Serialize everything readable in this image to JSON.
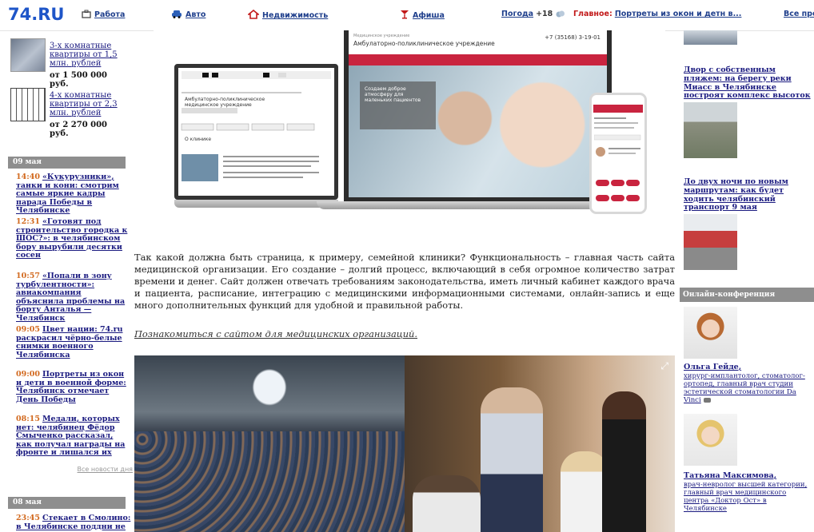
{
  "topbar": {
    "logo": "74.RU",
    "nav": [
      {
        "label": "Работа",
        "icon": "briefcase-icon"
      },
      {
        "label": "Авто",
        "icon": "car-icon"
      },
      {
        "label": "Недвижимость",
        "icon": "house-icon"
      },
      {
        "label": "Афиша",
        "icon": "cocktail-icon"
      }
    ],
    "weather": {
      "label": "Погода",
      "temp": "+18",
      "icon": "cloud-icon"
    },
    "headline_label": "Главное:",
    "headline": "Портреты из окон и детн в...",
    "all_label": "Все про"
  },
  "left": {
    "ads": [
      {
        "title": "3-х комнатные квартиры от 1,5 млн. рублей",
        "price": "от 1 500 000 руб."
      },
      {
        "title": "4-х комнатные квартиры от 2,3 млн. рублей",
        "price": "от 2 270 000 руб."
      }
    ],
    "dates": [
      "09 мая",
      "08 мая"
    ],
    "news": [
      {
        "time": "14:40",
        "text": "«Кукурузники», танки и кони: смотрим самые яркие кадры парада Победы в Челябинске"
      },
      {
        "time": "12:31",
        "text": "«Готовят под строительство городка к ШОС?»: в челябинском бору вырубили десятки сосен"
      },
      {
        "time": "10:57",
        "text": "«Попали в зону турбулентности»: авиакомпания объяснила проблемы на борту Анталья — Челябинск"
      },
      {
        "time": "09:05",
        "text": "Цвет нации: 74.ru раскрасил чёрно-белые снимки военного Челябинска"
      },
      {
        "time": "09:00",
        "text": "Портреты из окон и дети в военной форме: Челябинск отмечает День Победы"
      },
      {
        "time": "08:15",
        "text": "Медали, которых нет: челябинец Фёдор Смыченко рассказал, как получал награды на фронте и лишался их"
      },
      {
        "time": "23:45",
        "text": "Стекает в Смолино: в Челябинске поддни не"
      }
    ],
    "all_news": "Все новости дня"
  },
  "hero": {
    "site_small": "Медицинское учреждение",
    "site_title": "Амбулаторно-поликлиническое учреждение",
    "phone": "+7 (35168) 3-19-01",
    "slide_text": "Создаем доброе атмосферу для маленьких пациентов",
    "monitor_title": "Амбулаторно-поликлиническое медицинское учреждение",
    "monitor_sub": "О клинике"
  },
  "main": {
    "paragraph": "Так какой должна быть страница, к примеру, семейной клиники? Функциональность – главная часть сайта медицинской организации. Его создание – долгий процесс, включающий в себя огромное количество затрат времени и денег. Сайт должен отвечать требованиям законодательства, иметь личный кабинет каждого врача и пациента, расписание, интеграцию с медицинскими информационными системами, онлайн-запись и еще много дополнительных функций для удобной и правильной работы.",
    "more_link": "Познакомиться с сайтом для медицинских организаций."
  },
  "right": {
    "news": [
      "Двор с собственным пляжем: на берегу реки Миасс в Челябинске построят комплекс высоток",
      "До двух ночи по новым маршрутам: как будет ходить челябинский транспорт 9 мая"
    ],
    "conference_title": "Онлайн-конференция",
    "people": [
      {
        "name": "Ольга Гейде,",
        "desc": "хирург-имплантолог, стоматолог-ортопед, главный врач студии эстетической стоматологии Da Vinci"
      },
      {
        "name": "Татьяна Максимова,",
        "desc": "врач-невролог высшей категории, главный врач медицинского центра «Доктор Ост» в Челябинске"
      }
    ]
  }
}
